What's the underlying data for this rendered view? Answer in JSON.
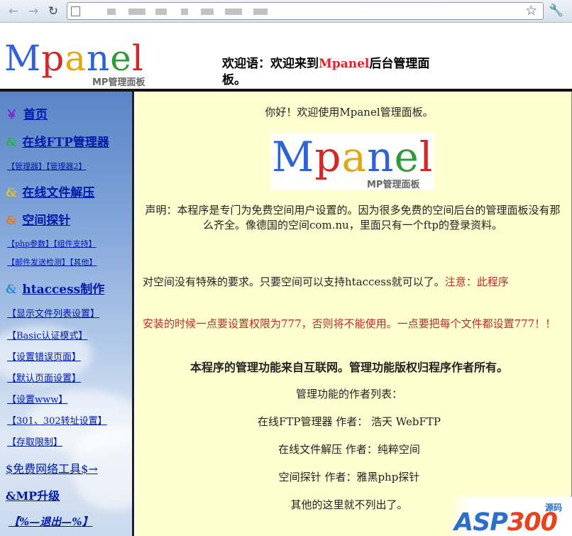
{
  "browser": {
    "back_icon": "←",
    "forward_icon": "→",
    "reload_icon": "↻",
    "star_icon": "☆",
    "wrench_icon": "🔧"
  },
  "header": {
    "logo": "Mpanel",
    "logo_sub": "MP管理面板",
    "welcome_prefix": "欢迎语：欢迎来到",
    "welcome_brand": "Mpanel",
    "welcome_suffix": "后台管理面板。"
  },
  "sidebar": {
    "home": {
      "bullet": "￥",
      "label": "首页"
    },
    "ftp": {
      "bullet": "&",
      "label": "在线FTP管理器"
    },
    "ftp_sub": "【管理器】【管理器2】",
    "unzip": {
      "bullet": "&",
      "label": "在线文件解压"
    },
    "probe": {
      "bullet": "&",
      "label": "空间探针"
    },
    "probe_sub1": "【php参数】【组件支持】",
    "probe_sub2": "【邮件发送检测】【其他】",
    "htaccess": {
      "bullet": "&",
      "label": "htaccess制作"
    },
    "ht_items": [
      "【显示文件列表设置】",
      "【Basic认证模式】",
      "【设置错误页面】",
      "【默认页面设置】",
      "【设置www】",
      "【301、302转址设置】",
      "【存取限制】"
    ],
    "tools": "$免费网络工具$→",
    "upgrade": "&MP升级",
    "logout": "【%—退出—%】"
  },
  "content": {
    "greeting": "你好！欢迎使用Mpanel管理面板。",
    "logo": "Mpanel",
    "logo_sub": "MP管理面板",
    "statement": "声明：本程序是专门为免费空间用户设置的。因为很多免费的空间后台的管理面板没有那么齐全。像德国的空间com.nu，里面只有一个ftp的登录资料。",
    "requirement_a": "对空间没有特殊的要求。只要空间可以支持htaccess就可以了。",
    "requirement_note": "注意：此程序",
    "install_note": "安装的时候一点要设置权限为777，否则将不能使用。一点要把每个文件都设置777！！",
    "copyright": "本程序的管理功能来自互联网。管理功能版权归程序作者所有。",
    "authors_title": "管理功能的作者列表：",
    "authors": [
      "在线FTP管理器 作者： 浩天 WebFTP",
      "在线文件解压 作者：纯粹空间",
      "空间探针 作者：雅黑php探针"
    ],
    "others": "其他的这里就不列出了。"
  },
  "watermark": {
    "text_a": "ASP",
    "text_b": "300",
    "cn": "源码"
  }
}
